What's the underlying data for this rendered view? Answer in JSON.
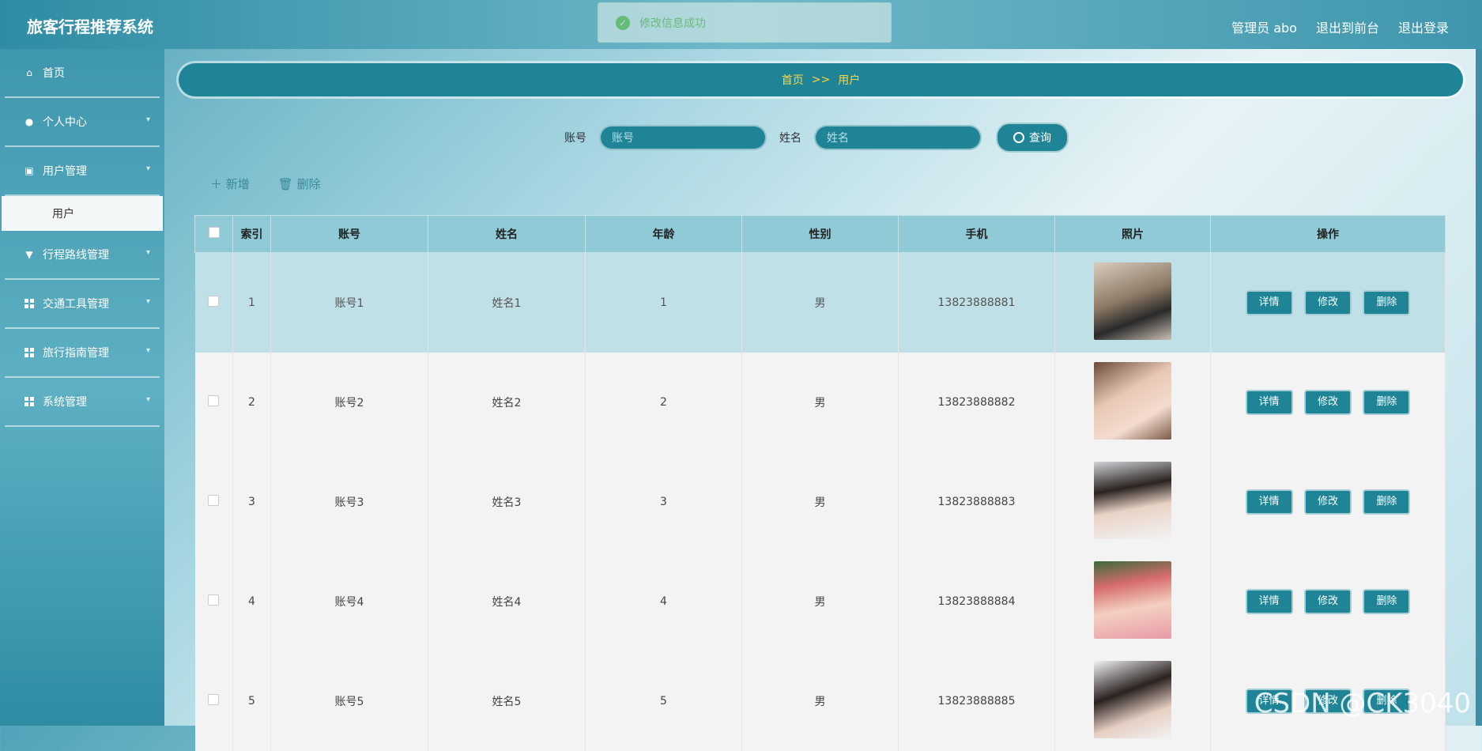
{
  "header": {
    "title": "旅客行程推荐系统",
    "admin": "管理员 abo",
    "to_front": "退出到前台",
    "logout": "退出登录"
  },
  "toast": {
    "message": "修改信息成功"
  },
  "sidebar": {
    "items": [
      {
        "label": "首页",
        "icon": "home-icon"
      },
      {
        "label": "个人中心",
        "icon": "user-icon"
      },
      {
        "label": "用户管理",
        "icon": "clipboard-icon"
      },
      {
        "label": "用户",
        "icon": ""
      },
      {
        "label": "行程路线管理",
        "icon": "route-icon"
      },
      {
        "label": "交通工具管理",
        "icon": "grid-icon"
      },
      {
        "label": "旅行指南管理",
        "icon": "grid-icon"
      },
      {
        "label": "系统管理",
        "icon": "grid-icon"
      }
    ]
  },
  "breadcrumb": {
    "home": "首页",
    "sep": ">>",
    "current": "用户"
  },
  "search": {
    "account_label": "账号",
    "account_placeholder": "账号",
    "name_label": "姓名",
    "name_placeholder": "姓名",
    "button": "查询"
  },
  "actions": {
    "add": "新增",
    "delete": "删除"
  },
  "table": {
    "headers": [
      "索引",
      "账号",
      "姓名",
      "年龄",
      "性别",
      "手机",
      "照片",
      "操作"
    ],
    "buttons": {
      "detail": "详情",
      "edit": "修改",
      "delete": "删除"
    },
    "rows": [
      {
        "index": "1",
        "account": "账号1",
        "name": "姓名1",
        "age": "1",
        "gender": "男",
        "phone": "13823888881"
      },
      {
        "index": "2",
        "account": "账号2",
        "name": "姓名2",
        "age": "2",
        "gender": "男",
        "phone": "13823888882"
      },
      {
        "index": "3",
        "account": "账号3",
        "name": "姓名3",
        "age": "3",
        "gender": "男",
        "phone": "13823888883"
      },
      {
        "index": "4",
        "account": "账号4",
        "name": "姓名4",
        "age": "4",
        "gender": "男",
        "phone": "13823888884"
      },
      {
        "index": "5",
        "account": "账号5",
        "name": "姓名5",
        "age": "5",
        "gender": "男",
        "phone": "13823888885"
      }
    ]
  },
  "watermark": "CSDN @CK3040",
  "colors": {
    "accent": "#1f8496",
    "header_bg": "#8fcad6",
    "highlight_row": "#bfe0e6"
  }
}
